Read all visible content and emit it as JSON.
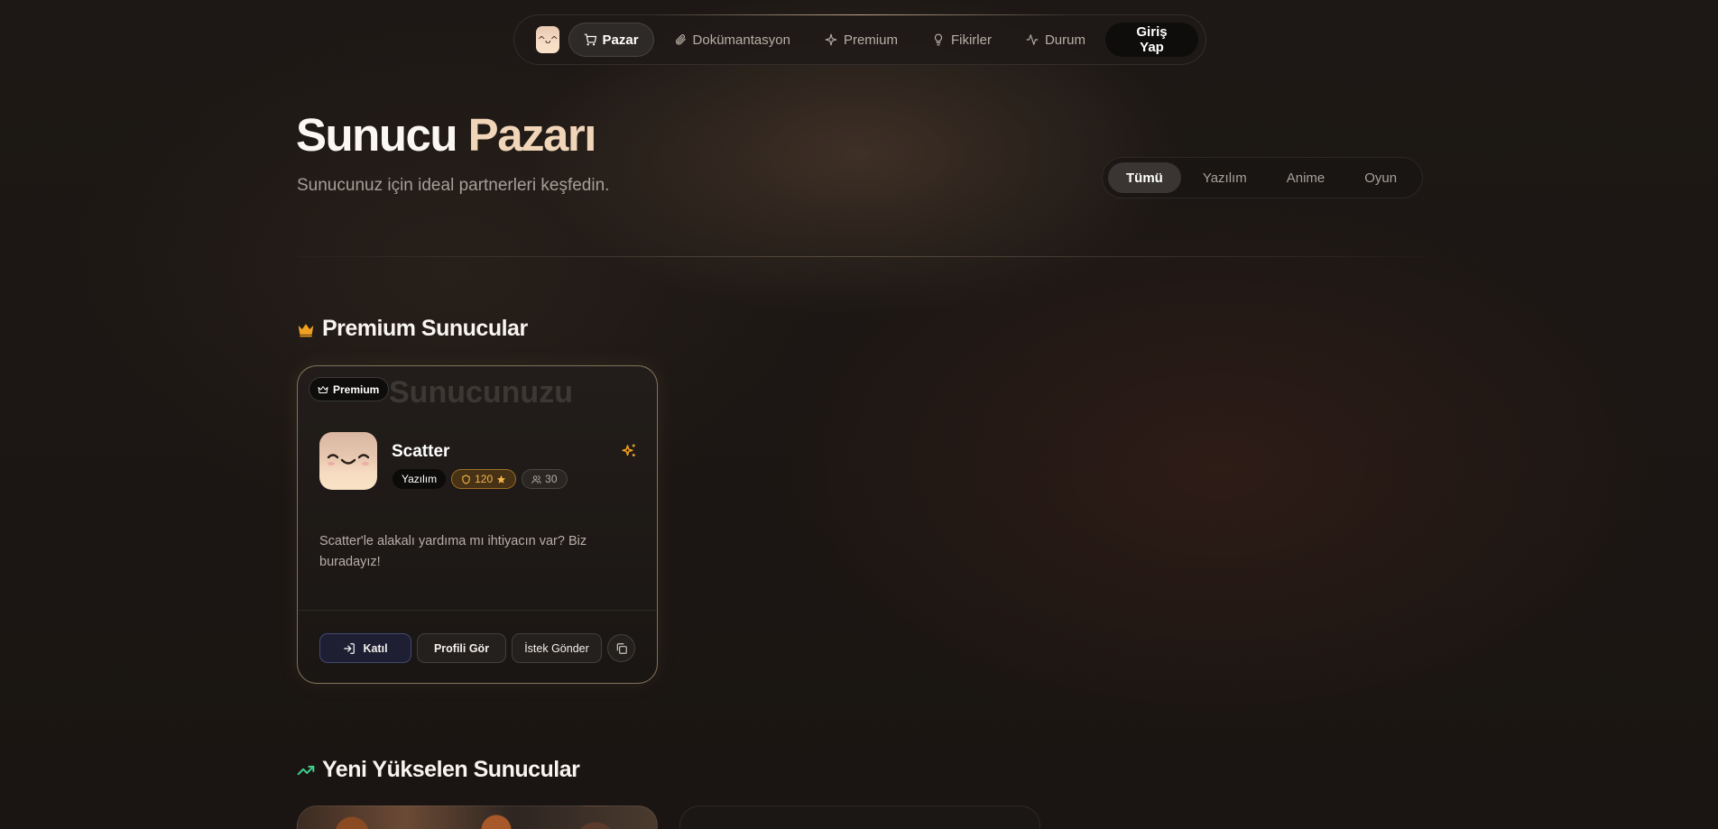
{
  "nav": {
    "logo_face": "^ᴗ^",
    "items": [
      {
        "label": "Pazar",
        "icon": "cart-icon",
        "active": true
      },
      {
        "label": "Dokümantasyon",
        "icon": "paperclip-icon",
        "active": false
      },
      {
        "label": "Premium",
        "icon": "sparkle-icon",
        "active": false
      },
      {
        "label": "Fikirler",
        "icon": "lightbulb-icon",
        "active": false
      },
      {
        "label": "Durum",
        "icon": "activity-icon",
        "active": false
      }
    ],
    "login": "Giriş Yap"
  },
  "hero": {
    "title_part1": "Sunucu",
    "title_part2": "Pazarı",
    "subtitle": "Sunucunuz için ideal partnerleri keşfedin."
  },
  "filters": {
    "items": [
      "Tümü",
      "Yazılım",
      "Anime",
      "Oyun"
    ],
    "active": "Tümü"
  },
  "premium_section": {
    "title": "Premium Sunucular",
    "icon": "crown-icon",
    "card": {
      "bg_text": "Sunucunuzu",
      "badge": "Premium",
      "name": "Scatter",
      "category": "Yazılım",
      "rating": "120",
      "members": "30",
      "description": "Scatter'le alakalı yardıma mı ihtiyacın var? Biz buradayız!",
      "actions": {
        "join": "Katıl",
        "profile": "Profili Gör",
        "request": "İstek Gönder"
      }
    }
  },
  "rising_section": {
    "title": "Yeni Yükselen Sunucular",
    "icon": "trending-up-icon"
  },
  "colors": {
    "background": "#1c1714",
    "accent_cream": "#f1d5b8",
    "crown": "#f0a020",
    "rating": "#f2b54a",
    "trend": "#3fcf8e"
  }
}
